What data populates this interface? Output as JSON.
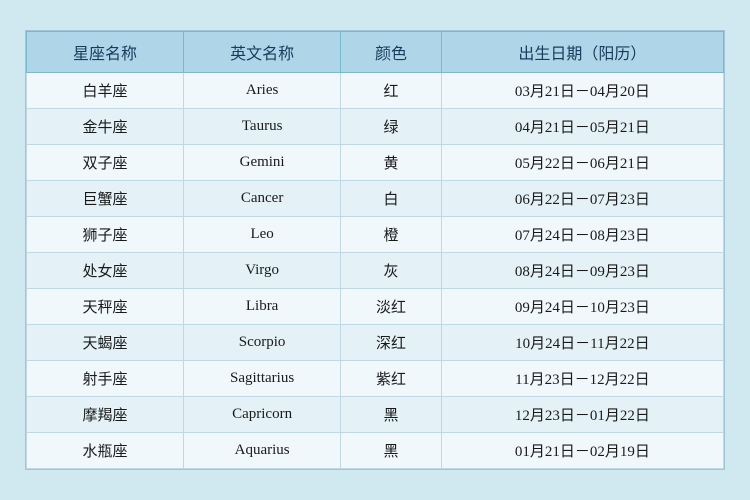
{
  "table": {
    "headers": [
      "星座名称",
      "英文名称",
      "颜色",
      "出生日期（阳历）"
    ],
    "rows": [
      [
        "白羊座",
        "Aries",
        "红",
        "03月21日－04月20日"
      ],
      [
        "金牛座",
        "Taurus",
        "绿",
        "04月21日－05月21日"
      ],
      [
        "双子座",
        "Gemini",
        "黄",
        "05月22日－06月21日"
      ],
      [
        "巨蟹座",
        "Cancer",
        "白",
        "06月22日－07月23日"
      ],
      [
        "狮子座",
        "Leo",
        "橙",
        "07月24日－08月23日"
      ],
      [
        "处女座",
        "Virgo",
        "灰",
        "08月24日－09月23日"
      ],
      [
        "天秤座",
        "Libra",
        "淡红",
        "09月24日－10月23日"
      ],
      [
        "天蝎座",
        "Scorpio",
        "深红",
        "10月24日－11月22日"
      ],
      [
        "射手座",
        "Sagittarius",
        "紫红",
        "11月23日－12月22日"
      ],
      [
        "摩羯座",
        "Capricorn",
        "黑",
        "12月23日－01月22日"
      ],
      [
        "水瓶座",
        "Aquarius",
        "黑",
        "01月21日－02月19日"
      ]
    ]
  }
}
